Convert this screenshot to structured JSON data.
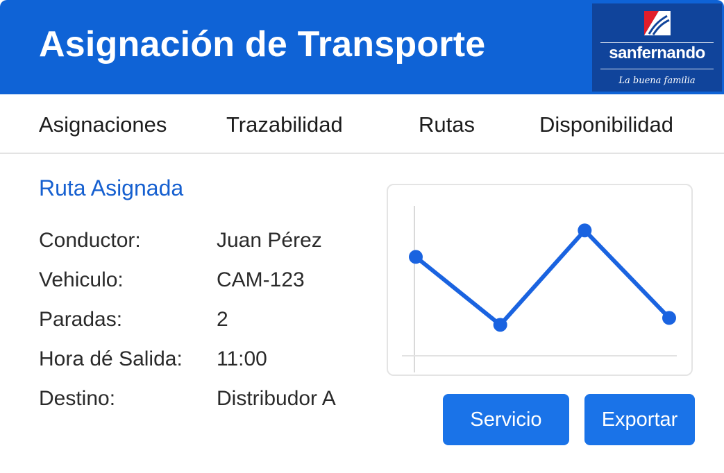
{
  "header": {
    "title": "Asignación de Transporte",
    "background_color": "#0f63d6",
    "logo": {
      "name": "sanfernando",
      "tagline": "La buena familia",
      "background_color": "#10449b",
      "accent_color": "#e11d2a"
    }
  },
  "tabs": [
    {
      "label": "Asignaciones"
    },
    {
      "label": "Trazabilidad"
    },
    {
      "label": "Rutas"
    },
    {
      "label": "Disponibilidad"
    }
  ],
  "route": {
    "title": "Ruta Asignada",
    "title_color": "#1660d0",
    "fields": [
      {
        "label": "Conductor:",
        "value": "Juan Pérez"
      },
      {
        "label": "Vehiculo:",
        "value": "CAM-123"
      },
      {
        "label": "Paradas:",
        "value": "2"
      },
      {
        "label": "Hora dé Salida:",
        "value": "11:00"
      },
      {
        "label": "Destino:",
        "value": "Distribudor A"
      }
    ]
  },
  "chart_data": {
    "type": "line",
    "title": "",
    "xlabel": "",
    "ylabel": "",
    "x": [
      1,
      2,
      3,
      4
    ],
    "series": [
      {
        "values": [
          0.63,
          0.04,
          0.86,
          0.1
        ]
      }
    ],
    "ylim": [
      0,
      1
    ],
    "grid": false,
    "line_color": "#1a63e0"
  },
  "actions": {
    "service_label": "Servicio",
    "export_label": "Exportar",
    "button_color": "#1a73e8"
  }
}
